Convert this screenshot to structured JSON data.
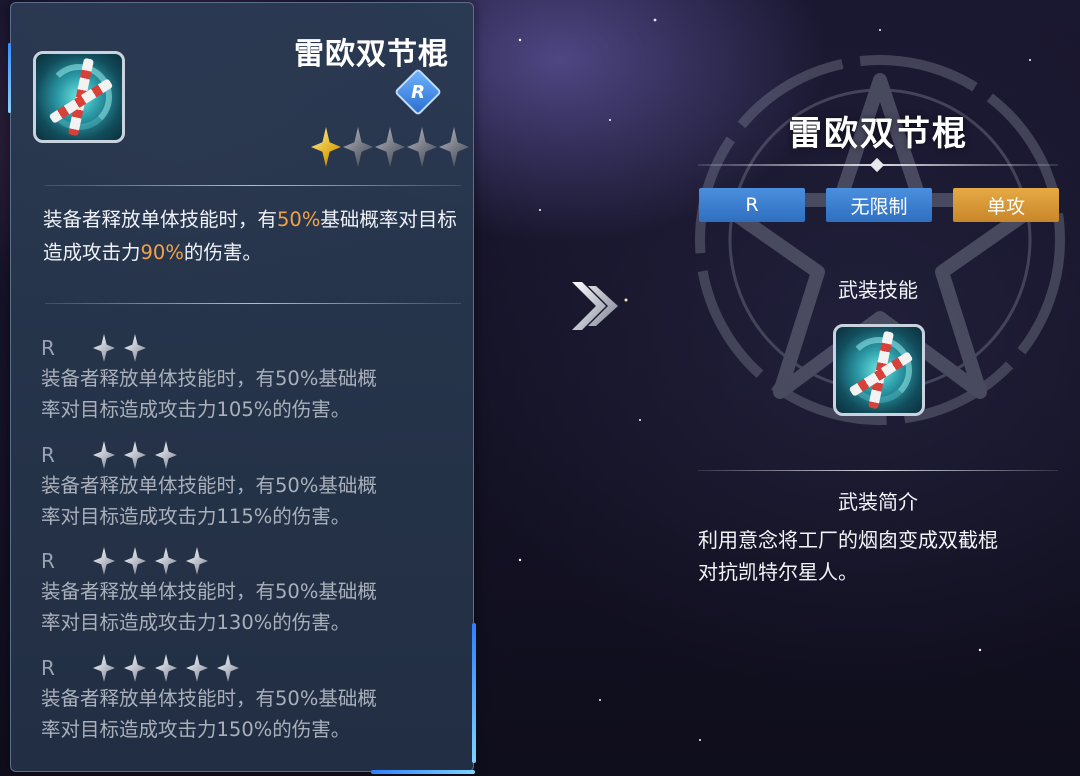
{
  "item": {
    "name": "雷欧双节棍",
    "rank": "R",
    "star_rating": 1,
    "star_max": 5,
    "effect_parts": [
      "装备者释放单体技能时，有",
      "50%",
      "基础概率对目标造成攻击力",
      "90%",
      "的伤害。"
    ]
  },
  "tiers": [
    {
      "grade": "R",
      "stars": 2,
      "line1": "装备者释放单体技能时，有50%基础概",
      "line2": "率对目标造成攻击力105%的伤害。"
    },
    {
      "grade": "R",
      "stars": 3,
      "line1": "装备者释放单体技能时，有50%基础概",
      "line2": "率对目标造成攻击力115%的伤害。"
    },
    {
      "grade": "R",
      "stars": 4,
      "line1": "装备者释放单体技能时，有50%基础概",
      "line2": "率对目标造成攻击力130%的伤害。"
    },
    {
      "grade": "R",
      "stars": 5,
      "line1": "装备者释放单体技能时，有50%基础概",
      "line2": "率对目标造成攻击力150%的伤害。"
    }
  ],
  "detail": {
    "title": "雷欧双节棍",
    "tags": [
      "R",
      "无限制",
      "单攻"
    ],
    "skill_label": "武装技能",
    "intro_label": "武装简介",
    "intro_line1": "利用意念将工厂的烟囱变成双截棍",
    "intro_line2": "对抗凯特尔星人。"
  },
  "colors": {
    "highlight": "#f0a24a",
    "tag_blue": "#3a7ccc",
    "tag_gold": "#d8952f"
  }
}
